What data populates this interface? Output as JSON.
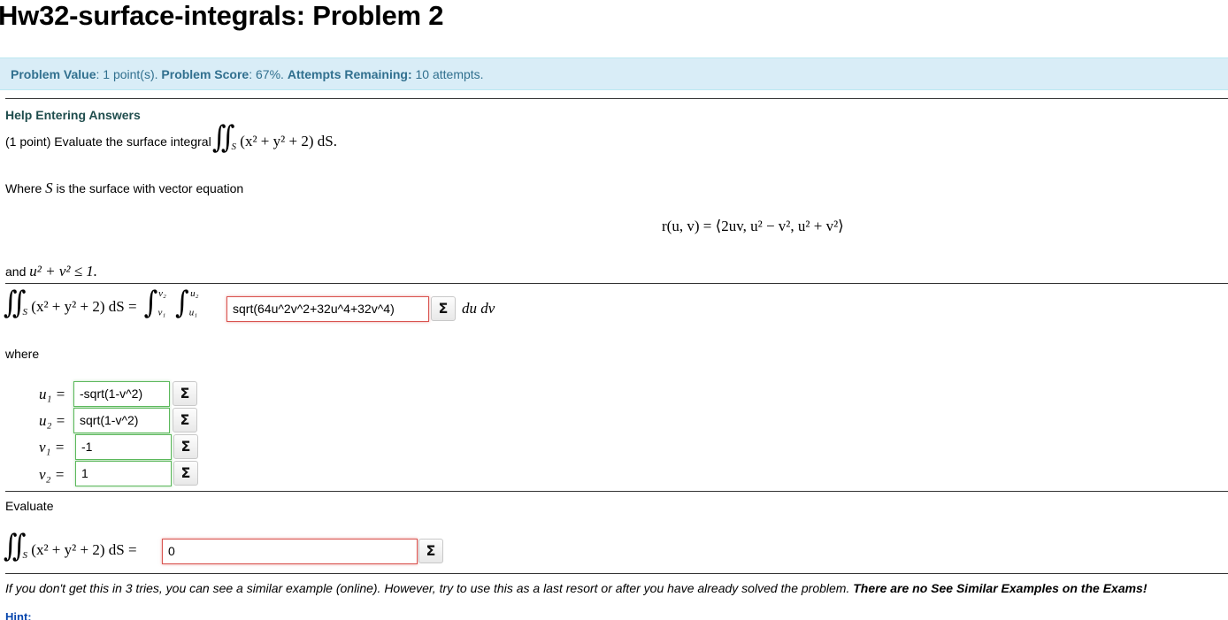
{
  "header": {
    "title": "Hw32-surface-integrals: Problem 2"
  },
  "score_bar": {
    "value_label": "Problem Value",
    "value_text": ": 1 point(s).",
    "score_label": "Problem Score",
    "score_text": ": 67%.",
    "attempts_label": "Attempts Remaining:",
    "attempts_text": "10 attempts."
  },
  "help": {
    "link_label": "Help Entering Answers"
  },
  "problem": {
    "intro": "(1 point) Evaluate the surface integral",
    "where_surface_prefix": "Where",
    "where_surface_var": "S",
    "where_surface_suffix": "is the surface with vector equation",
    "vector_equation": "r(u, v) = ⟨2uv, u² − v², u² + v²⟩",
    "constraint_prefix": "and",
    "constraint_math": "u² + v² ≤ 1.",
    "integrand_math": "(x² + y² + 2)  dS",
    "du_dv": "du dv",
    "where_label": "where",
    "evaluate_label": "Evaluate"
  },
  "answers": {
    "integrand": {
      "value": "sqrt(64u^2v^2+32u^4+32v^4)",
      "status": "incorrect"
    },
    "u1": {
      "label": "u₁ =",
      "value": "-sqrt(1-v^2)",
      "status": "correct"
    },
    "u2": {
      "label": "u₂ =",
      "value": "sqrt(1-v^2)",
      "status": "correct"
    },
    "v1": {
      "label": "v₁ =",
      "value": "-1",
      "status": "correct"
    },
    "v2": {
      "label": "v₂ =",
      "value": "1",
      "status": "correct"
    },
    "final": {
      "value": "0",
      "status": "incorrect"
    }
  },
  "equation_editor": {
    "icon": "sigma-icon",
    "glyph": "Σ"
  },
  "footer": {
    "note": "If you don't get this in 3 tries, you can see a similar example (online). However, try to use this as a last resort or after you have already solved the problem. ",
    "note_bold": "There are no See Similar Examples on the Exams!",
    "hint_label": "Hint:"
  },
  "colors": {
    "score_bar_bg": "#d9edf7",
    "score_bar_text": "#31708f",
    "correct_border": "#5cb85c",
    "incorrect_border": "#d9534f"
  }
}
